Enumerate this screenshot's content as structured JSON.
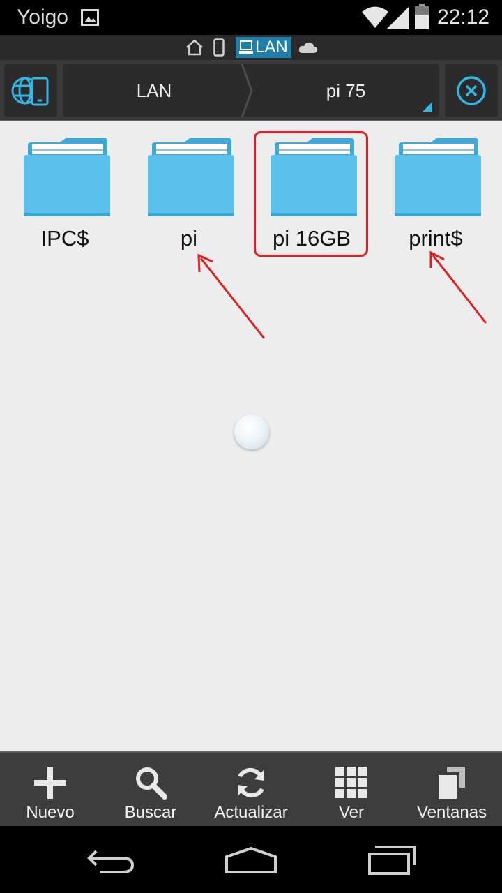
{
  "status_bar": {
    "carrier": "Yoigo",
    "time": "22:12"
  },
  "location_strip": {
    "active_label": "LAN"
  },
  "breadcrumbs": [
    {
      "label": "LAN"
    },
    {
      "label": "pi 75"
    }
  ],
  "folders": [
    {
      "name": "IPC$"
    },
    {
      "name": "pi"
    },
    {
      "name": "pi 16GB"
    },
    {
      "name": "print$"
    }
  ],
  "actions": [
    {
      "label": "Nuevo",
      "icon": "plus-icon"
    },
    {
      "label": "Buscar",
      "icon": "search-icon"
    },
    {
      "label": "Actualizar",
      "icon": "refresh-icon"
    },
    {
      "label": "Ver",
      "icon": "grid-icon"
    },
    {
      "label": "Ventanas",
      "icon": "windows-icon"
    }
  ],
  "colors": {
    "accent": "#33b5e5",
    "folder": "#5bc0ec",
    "annotation": "#e02020"
  }
}
